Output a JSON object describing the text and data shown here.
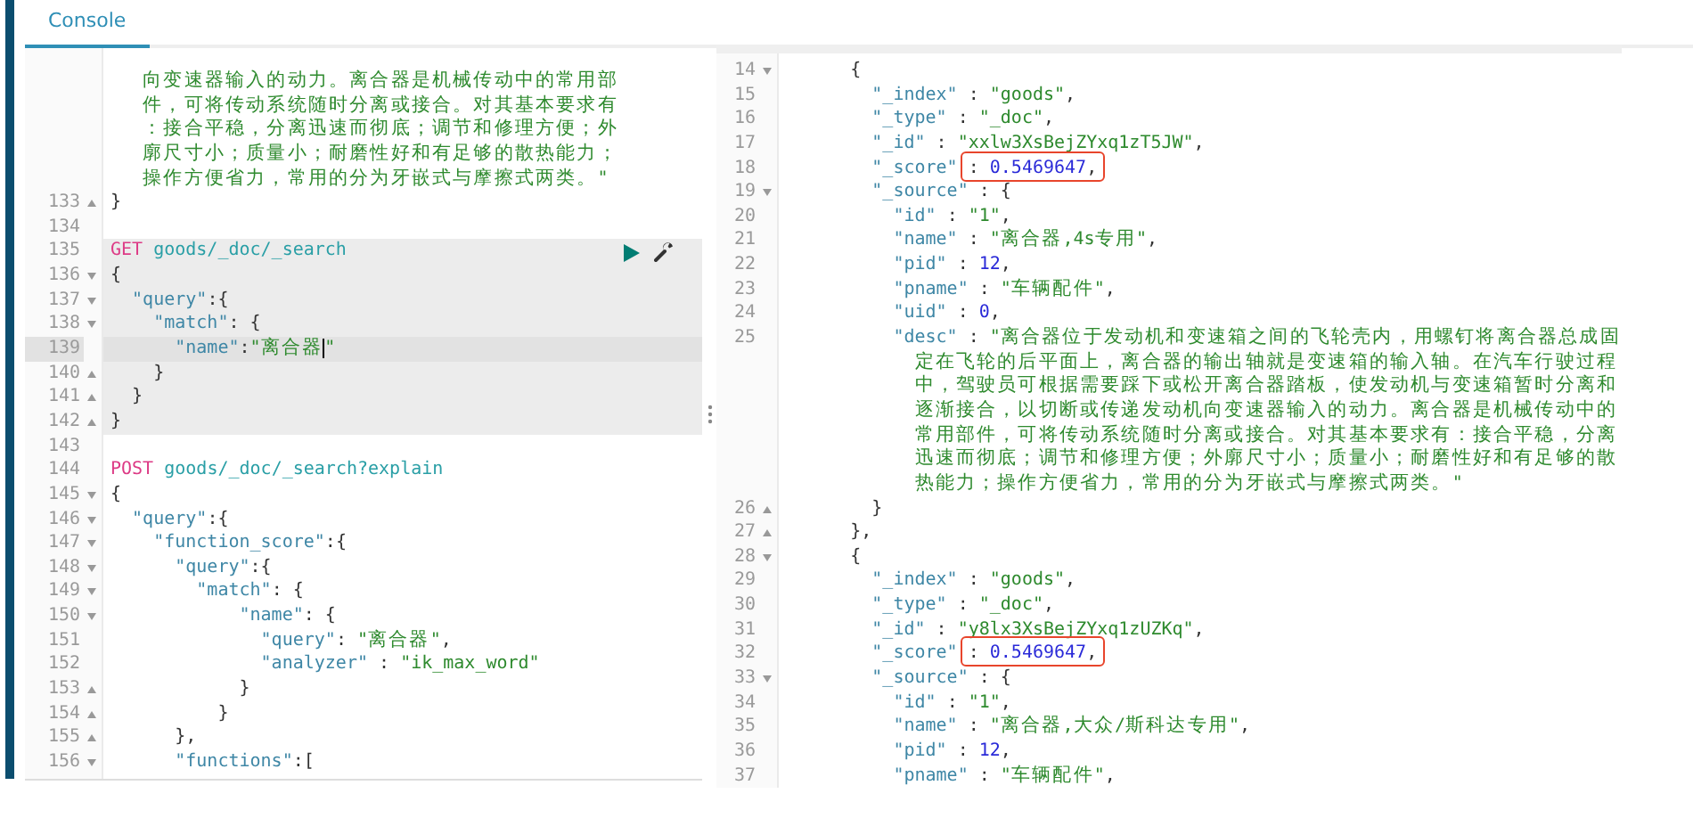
{
  "tabs": [
    {
      "label": "Console",
      "selected": true
    }
  ],
  "request_pane": {
    "lines": [
      {
        "tokens": [
          {
            "kind": "string",
            "text": "   向变速器输入的动力。离合器是机械传动中的常用部"
          }
        ]
      },
      {
        "tokens": [
          {
            "kind": "string",
            "text": "   件，可将传动系统随时分离或接合。对其基本要求有"
          }
        ]
      },
      {
        "tokens": [
          {
            "kind": "string",
            "text": "   ：接合平稳，分离迅速而彻底；调节和修理方便；外"
          }
        ]
      },
      {
        "tokens": [
          {
            "kind": "string",
            "text": "   廓尺寸小；质量小；耐磨性好和有足够的散热能力；"
          }
        ]
      },
      {
        "tokens": [
          {
            "kind": "string",
            "text": "   操作方便省力，常用的分为牙嵌式与摩擦式两类。\""
          }
        ]
      },
      {
        "number": "133",
        "fold_end": true,
        "tokens": [
          {
            "kind": "punct",
            "text": "}"
          }
        ]
      },
      {
        "number": "134"
      },
      {
        "number": "135",
        "active_request": true,
        "actions": true,
        "tokens": [
          {
            "kind": "method",
            "text": "GET"
          },
          {
            "kind": "url",
            "text": " goods/_doc/_search"
          }
        ]
      },
      {
        "number": "136",
        "fold_start": true,
        "active_request": true,
        "tokens": [
          {
            "kind": "punct",
            "text": "{"
          }
        ]
      },
      {
        "number": "137",
        "fold_start": true,
        "active_request": true,
        "tokens": [
          {
            "kind": "key",
            "text": "  \"query\""
          },
          {
            "kind": "punct",
            "text": ":{"
          }
        ]
      },
      {
        "number": "138",
        "fold_start": true,
        "active_request": true,
        "tokens": [
          {
            "kind": "key",
            "text": "    \"match\""
          },
          {
            "kind": "punct",
            "text": ": {"
          }
        ]
      },
      {
        "number": "139",
        "active_request": true,
        "current": true,
        "tokens": [
          {
            "kind": "key",
            "text": "      \"name\""
          },
          {
            "kind": "punct",
            "text": ":"
          },
          {
            "kind": "string",
            "text": "\"离合器"
          },
          {
            "kind": "string",
            "text": "\"",
            "caret_before": true
          }
        ]
      },
      {
        "number": "140",
        "fold_end": true,
        "active_request": true,
        "tokens": [
          {
            "kind": "punct",
            "text": "    }"
          }
        ]
      },
      {
        "number": "141",
        "fold_end": true,
        "active_request": true,
        "tokens": [
          {
            "kind": "punct",
            "text": "  }"
          }
        ]
      },
      {
        "number": "142",
        "fold_end": true,
        "active_request": true,
        "tokens": [
          {
            "kind": "punct",
            "text": "}"
          }
        ]
      },
      {
        "number": "143"
      },
      {
        "number": "144",
        "tokens": [
          {
            "kind": "method",
            "text": "POST"
          },
          {
            "kind": "url",
            "text": " goods/_doc/_search?explain"
          }
        ]
      },
      {
        "number": "145",
        "fold_start": true,
        "tokens": [
          {
            "kind": "punct",
            "text": "{"
          }
        ]
      },
      {
        "number": "146",
        "fold_start": true,
        "tokens": [
          {
            "kind": "key",
            "text": "  \"query\""
          },
          {
            "kind": "punct",
            "text": ":{"
          }
        ]
      },
      {
        "number": "147",
        "fold_start": true,
        "tokens": [
          {
            "kind": "key",
            "text": "    \"function_score\""
          },
          {
            "kind": "punct",
            "text": ":{"
          }
        ]
      },
      {
        "number": "148",
        "fold_start": true,
        "tokens": [
          {
            "kind": "key",
            "text": "      \"query\""
          },
          {
            "kind": "punct",
            "text": ":{"
          }
        ]
      },
      {
        "number": "149",
        "fold_start": true,
        "tokens": [
          {
            "kind": "key",
            "text": "        \"match\""
          },
          {
            "kind": "punct",
            "text": ": {"
          }
        ]
      },
      {
        "number": "150",
        "fold_start": true,
        "tokens": [
          {
            "kind": "key",
            "text": "            \"name\""
          },
          {
            "kind": "punct",
            "text": ": {"
          }
        ]
      },
      {
        "number": "151",
        "tokens": [
          {
            "kind": "key",
            "text": "              \"query\""
          },
          {
            "kind": "punct",
            "text": ": "
          },
          {
            "kind": "string",
            "text": "\"离合器\""
          },
          {
            "kind": "punct",
            "text": ","
          }
        ]
      },
      {
        "number": "152",
        "tokens": [
          {
            "kind": "key",
            "text": "              \"analyzer\""
          },
          {
            "kind": "punct",
            "text": " : "
          },
          {
            "kind": "string",
            "text": "\"ik_max_word\""
          }
        ]
      },
      {
        "number": "153",
        "fold_end": true,
        "tokens": [
          {
            "kind": "punct",
            "text": "            }"
          }
        ]
      },
      {
        "number": "154",
        "fold_end": true,
        "tokens": [
          {
            "kind": "punct",
            "text": "          }"
          }
        ]
      },
      {
        "number": "155",
        "fold_end": true,
        "tokens": [
          {
            "kind": "punct",
            "text": "      },"
          }
        ]
      },
      {
        "number": "156",
        "fold_start": true,
        "tokens": [
          {
            "kind": "key",
            "text": "      \"functions\""
          },
          {
            "kind": "punct",
            "text": ":["
          }
        ]
      }
    ]
  },
  "response_pane": {
    "lines": [
      {
        "number": "14",
        "fold_start": true,
        "tokens": [
          {
            "kind": "punct",
            "text": "      {"
          }
        ]
      },
      {
        "number": "15",
        "tokens": [
          {
            "kind": "key",
            "text": "        \"_index\""
          },
          {
            "kind": "punct",
            "text": " : "
          },
          {
            "kind": "string",
            "text": "\"goods\""
          },
          {
            "kind": "punct",
            "text": ","
          }
        ]
      },
      {
        "number": "16",
        "tokens": [
          {
            "kind": "key",
            "text": "        \"_type\""
          },
          {
            "kind": "punct",
            "text": " : "
          },
          {
            "kind": "string",
            "text": "\"_doc\""
          },
          {
            "kind": "punct",
            "text": ","
          }
        ]
      },
      {
        "number": "17",
        "tokens": [
          {
            "kind": "key",
            "text": "        \"_id\""
          },
          {
            "kind": "punct",
            "text": " : "
          },
          {
            "kind": "string",
            "text": "\"xxlw3XsBejZYxq1zT5JW\""
          },
          {
            "kind": "punct",
            "text": ","
          }
        ]
      },
      {
        "number": "18",
        "tokens": [
          {
            "kind": "key",
            "text": "        \"_score\""
          },
          {
            "kind": "punct",
            "text": " : ",
            "boxed": true
          },
          {
            "kind": "number",
            "text": "0.5469647",
            "boxed": true
          },
          {
            "kind": "punct",
            "text": ",",
            "boxed": true
          }
        ]
      },
      {
        "number": "19",
        "fold_start": true,
        "tokens": [
          {
            "kind": "key",
            "text": "        \"_source\""
          },
          {
            "kind": "punct",
            "text": " : {"
          }
        ]
      },
      {
        "number": "20",
        "tokens": [
          {
            "kind": "key",
            "text": "          \"id\""
          },
          {
            "kind": "punct",
            "text": " : "
          },
          {
            "kind": "string",
            "text": "\"1\""
          },
          {
            "kind": "punct",
            "text": ","
          }
        ]
      },
      {
        "number": "21",
        "tokens": [
          {
            "kind": "key",
            "text": "          \"name\""
          },
          {
            "kind": "punct",
            "text": " : "
          },
          {
            "kind": "string",
            "text": "\"离合器,4s专用\""
          },
          {
            "kind": "punct",
            "text": ","
          }
        ]
      },
      {
        "number": "22",
        "tokens": [
          {
            "kind": "key",
            "text": "          \"pid\""
          },
          {
            "kind": "punct",
            "text": " : "
          },
          {
            "kind": "number",
            "text": "12"
          },
          {
            "kind": "punct",
            "text": ","
          }
        ]
      },
      {
        "number": "23",
        "tokens": [
          {
            "kind": "key",
            "text": "          \"pname\""
          },
          {
            "kind": "punct",
            "text": " : "
          },
          {
            "kind": "string",
            "text": "\"车辆配件\""
          },
          {
            "kind": "punct",
            "text": ","
          }
        ]
      },
      {
        "number": "24",
        "tokens": [
          {
            "kind": "key",
            "text": "          \"uid\""
          },
          {
            "kind": "punct",
            "text": " : "
          },
          {
            "kind": "number",
            "text": "0"
          },
          {
            "kind": "punct",
            "text": ","
          }
        ]
      },
      {
        "number": "25",
        "tokens": [
          {
            "kind": "key",
            "text": "          \"desc\""
          },
          {
            "kind": "punct",
            "text": " : "
          },
          {
            "kind": "string",
            "text": "\"离合器位于发动机和变速箱之间的飞轮壳内，用螺钉将离合器总成固"
          }
        ]
      },
      {
        "tokens": [
          {
            "kind": "string",
            "text": "            定在飞轮的后平面上，离合器的输出轴就是变速箱的输入轴。在汽车行驶过程"
          }
        ]
      },
      {
        "tokens": [
          {
            "kind": "string",
            "text": "            中，驾驶员可根据需要踩下或松开离合器踏板，使发动机与变速箱暂时分离和"
          }
        ]
      },
      {
        "tokens": [
          {
            "kind": "string",
            "text": "            逐渐接合，以切断或传递发动机向变速器输入的动力。离合器是机械传动中的"
          }
        ]
      },
      {
        "tokens": [
          {
            "kind": "string",
            "text": "            常用部件，可将传动系统随时分离或接合。对其基本要求有：接合平稳，分离"
          }
        ]
      },
      {
        "tokens": [
          {
            "kind": "string",
            "text": "            迅速而彻底；调节和修理方便；外廓尺寸小；质量小；耐磨性好和有足够的散"
          }
        ]
      },
      {
        "tokens": [
          {
            "kind": "string",
            "text": "            热能力；操作方便省力，常用的分为牙嵌式与摩擦式两类。\""
          }
        ]
      },
      {
        "number": "26",
        "fold_end": true,
        "tokens": [
          {
            "kind": "punct",
            "text": "        }"
          }
        ]
      },
      {
        "number": "27",
        "fold_end": true,
        "tokens": [
          {
            "kind": "punct",
            "text": "      },"
          }
        ]
      },
      {
        "number": "28",
        "fold_start": true,
        "tokens": [
          {
            "kind": "punct",
            "text": "      {"
          }
        ]
      },
      {
        "number": "29",
        "tokens": [
          {
            "kind": "key",
            "text": "        \"_index\""
          },
          {
            "kind": "punct",
            "text": " : "
          },
          {
            "kind": "string",
            "text": "\"goods\""
          },
          {
            "kind": "punct",
            "text": ","
          }
        ]
      },
      {
        "number": "30",
        "tokens": [
          {
            "kind": "key",
            "text": "        \"_type\""
          },
          {
            "kind": "punct",
            "text": " : "
          },
          {
            "kind": "string",
            "text": "\"_doc\""
          },
          {
            "kind": "punct",
            "text": ","
          }
        ]
      },
      {
        "number": "31",
        "tokens": [
          {
            "kind": "key",
            "text": "        \"_id\""
          },
          {
            "kind": "punct",
            "text": " : "
          },
          {
            "kind": "string",
            "text": "\"y8lx3XsBejZYxq1zUZKq\""
          },
          {
            "kind": "punct",
            "text": ","
          }
        ]
      },
      {
        "number": "32",
        "tokens": [
          {
            "kind": "key",
            "text": "        \"_score\""
          },
          {
            "kind": "punct",
            "text": " : ",
            "boxed": true
          },
          {
            "kind": "number",
            "text": "0.5469647",
            "boxed": true
          },
          {
            "kind": "punct",
            "text": ",",
            "boxed": true
          }
        ]
      },
      {
        "number": "33",
        "fold_start": true,
        "tokens": [
          {
            "kind": "key",
            "text": "        \"_source\""
          },
          {
            "kind": "punct",
            "text": " : {"
          }
        ]
      },
      {
        "number": "34",
        "tokens": [
          {
            "kind": "key",
            "text": "          \"id\""
          },
          {
            "kind": "punct",
            "text": " : "
          },
          {
            "kind": "string",
            "text": "\"1\""
          },
          {
            "kind": "punct",
            "text": ","
          }
        ]
      },
      {
        "number": "35",
        "tokens": [
          {
            "kind": "key",
            "text": "          \"name\""
          },
          {
            "kind": "punct",
            "text": " : "
          },
          {
            "kind": "string",
            "text": "\"离合器,大众/斯科达专用\""
          },
          {
            "kind": "punct",
            "text": ","
          }
        ]
      },
      {
        "number": "36",
        "tokens": [
          {
            "kind": "key",
            "text": "          \"pid\""
          },
          {
            "kind": "punct",
            "text": " : "
          },
          {
            "kind": "number",
            "text": "12"
          },
          {
            "kind": "punct",
            "text": ","
          }
        ]
      },
      {
        "number": "37",
        "tokens": [
          {
            "kind": "key",
            "text": "          \"pname\""
          },
          {
            "kind": "punct",
            "text": " : "
          },
          {
            "kind": "string",
            "text": "\"车辆配件\""
          },
          {
            "kind": "punct",
            "text": ","
          }
        ]
      }
    ]
  }
}
